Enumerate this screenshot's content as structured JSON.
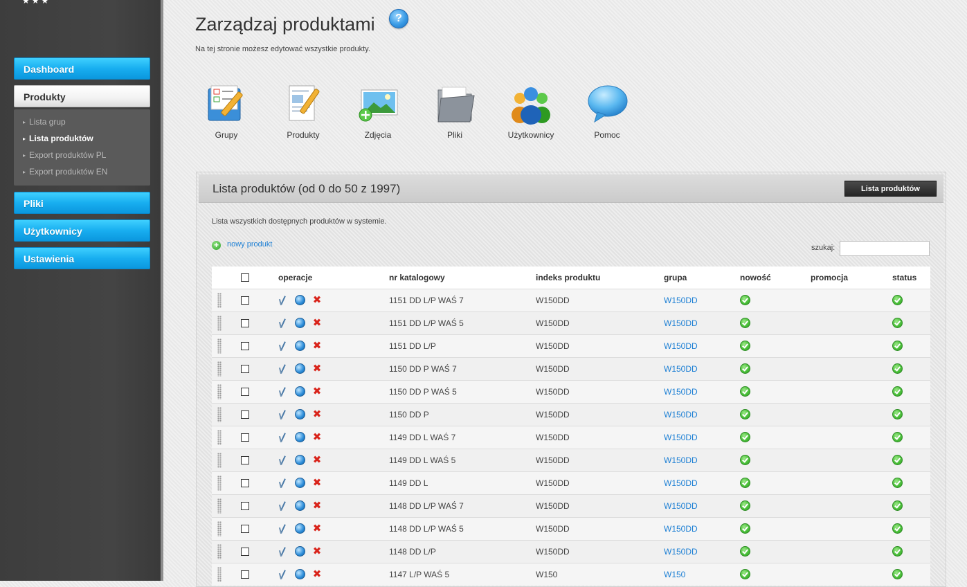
{
  "sidebar": {
    "nav": [
      {
        "label": "Dashboard"
      },
      {
        "label": "Produkty"
      },
      {
        "label": "Pliki"
      },
      {
        "label": "Użytkownicy"
      },
      {
        "label": "Ustawienia"
      }
    ],
    "subnav": [
      {
        "label": "Lista grup"
      },
      {
        "label": "Lista produktów"
      },
      {
        "label": "Export produktów PL"
      },
      {
        "label": "Export produktów EN"
      }
    ]
  },
  "header": {
    "title": "Zarządzaj produktami",
    "help_icon": "?",
    "subtitle": "Na tej stronie możesz edytować wszystkie produkty."
  },
  "quick_links": [
    {
      "label": "Grupy"
    },
    {
      "label": "Produkty"
    },
    {
      "label": "Zdjęcia"
    },
    {
      "label": "Pliki"
    },
    {
      "label": "Użytkownicy"
    },
    {
      "label": "Pomoc"
    }
  ],
  "panel": {
    "title": "Lista produktów (od 0 do 50 z 1997)",
    "button_label": "Lista produktów",
    "description": "Lista wszystkich dostępnych produktów w systemie.",
    "new_product_label": "nowy produkt",
    "search_label": "szukaj:",
    "search_value": ""
  },
  "table": {
    "columns": [
      "operacje",
      "nr katalogowy",
      "indeks produktu",
      "grupa",
      "nowość",
      "promocja",
      "status"
    ],
    "rows": [
      {
        "catalog": "1151 DD L/P WAŚ 7",
        "index": "W150DD",
        "group": "W150DD"
      },
      {
        "catalog": "1151 DD L/P WAŚ 5",
        "index": "W150DD",
        "group": "W150DD"
      },
      {
        "catalog": "1151 DD L/P",
        "index": "W150DD",
        "group": "W150DD"
      },
      {
        "catalog": "1150 DD P WAŚ 7",
        "index": "W150DD",
        "group": "W150DD"
      },
      {
        "catalog": "1150 DD P WAŚ 5",
        "index": "W150DD",
        "group": "W150DD"
      },
      {
        "catalog": "1150 DD P",
        "index": "W150DD",
        "group": "W150DD"
      },
      {
        "catalog": "1149 DD L WAŚ 7",
        "index": "W150DD",
        "group": "W150DD"
      },
      {
        "catalog": "1149 DD L WAŚ 5",
        "index": "W150DD",
        "group": "W150DD"
      },
      {
        "catalog": "1149 DD L",
        "index": "W150DD",
        "group": "W150DD"
      },
      {
        "catalog": "1148 DD L/P WAŚ 7",
        "index": "W150DD",
        "group": "W150DD"
      },
      {
        "catalog": "1148 DD L/P WAŚ 5",
        "index": "W150DD",
        "group": "W150DD"
      },
      {
        "catalog": "1148 DD L/P",
        "index": "W150DD",
        "group": "W150DD"
      },
      {
        "catalog": "1147 L/P WAŚ 5",
        "index": "W150",
        "group": "W150"
      }
    ]
  },
  "icons": {
    "nav_arrow": "▸",
    "delete": "✖",
    "plus": "+",
    "stars": "★★★"
  },
  "colors": {
    "accent_blue": "#18aef0",
    "link_blue": "#1c7fd4",
    "status_green": "#4cc13b",
    "delete_red": "#d9241b"
  }
}
